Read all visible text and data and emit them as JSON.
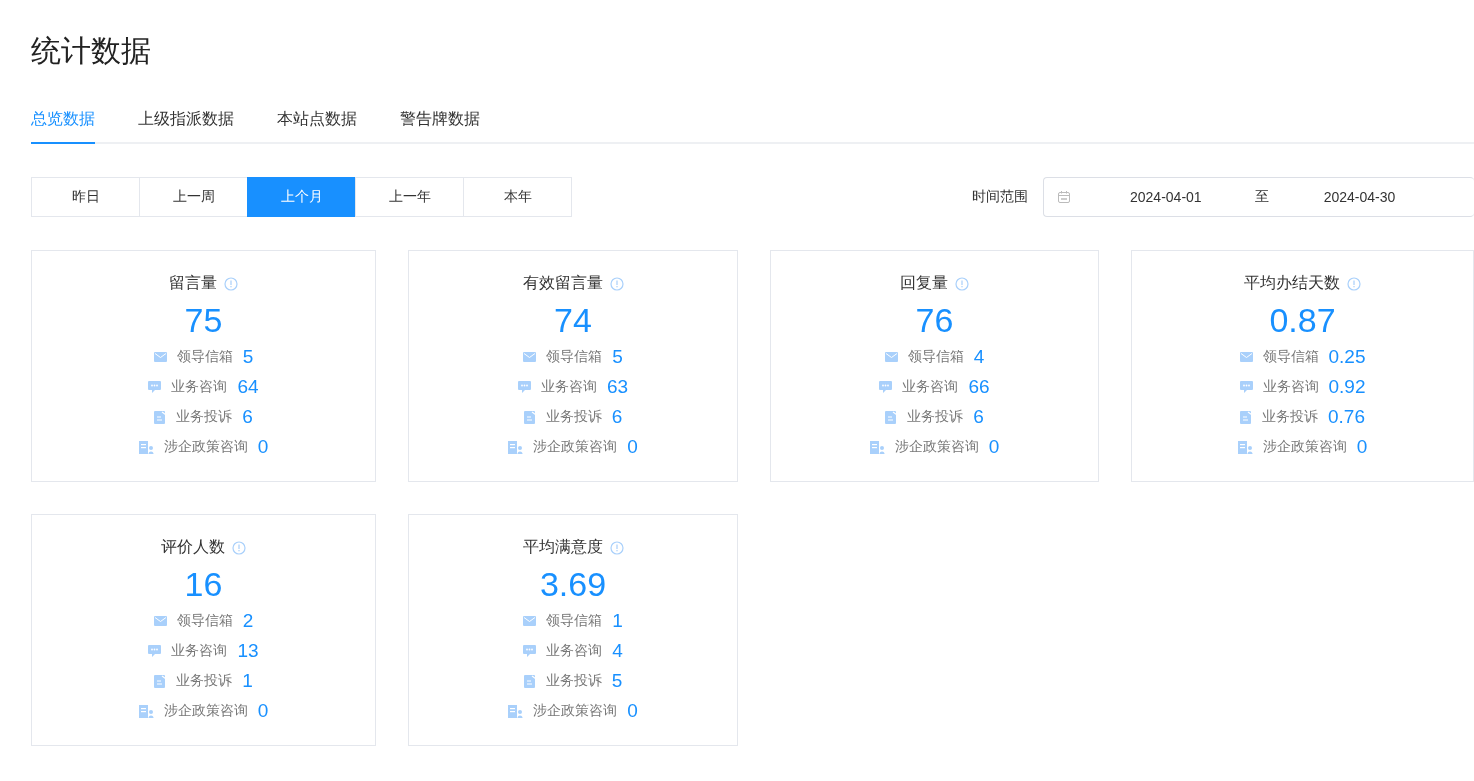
{
  "page_title": "统计数据",
  "tabs": [
    {
      "label": "总览数据",
      "selected": true
    },
    {
      "label": "上级指派数据",
      "selected": false
    },
    {
      "label": "本站点数据",
      "selected": false
    },
    {
      "label": "警告牌数据",
      "selected": false
    }
  ],
  "periods": [
    {
      "label": "昨日",
      "selected": false
    },
    {
      "label": "上一周",
      "selected": false
    },
    {
      "label": "上个月",
      "selected": true
    },
    {
      "label": "上一年",
      "selected": false
    },
    {
      "label": "本年",
      "selected": false
    }
  ],
  "date_range": {
    "label": "时间范围",
    "start": "2024-04-01",
    "separator": "至",
    "end": "2024-04-30"
  },
  "cards": [
    {
      "title": "留言量",
      "value": "75",
      "items": [
        {
          "kind": "mail",
          "label": "领导信箱",
          "value": "5"
        },
        {
          "kind": "chat",
          "label": "业务咨询",
          "value": "64"
        },
        {
          "kind": "note",
          "label": "业务投诉",
          "value": "6"
        },
        {
          "kind": "building",
          "label": "涉企政策咨询",
          "value": "0"
        }
      ]
    },
    {
      "title": "有效留言量",
      "value": "74",
      "items": [
        {
          "kind": "mail",
          "label": "领导信箱",
          "value": "5"
        },
        {
          "kind": "chat",
          "label": "业务咨询",
          "value": "63"
        },
        {
          "kind": "note",
          "label": "业务投诉",
          "value": "6"
        },
        {
          "kind": "building",
          "label": "涉企政策咨询",
          "value": "0"
        }
      ]
    },
    {
      "title": "回复量",
      "value": "76",
      "items": [
        {
          "kind": "mail",
          "label": "领导信箱",
          "value": "4"
        },
        {
          "kind": "chat",
          "label": "业务咨询",
          "value": "66"
        },
        {
          "kind": "note",
          "label": "业务投诉",
          "value": "6"
        },
        {
          "kind": "building",
          "label": "涉企政策咨询",
          "value": "0"
        }
      ]
    },
    {
      "title": "平均办结天数",
      "value": "0.87",
      "items": [
        {
          "kind": "mail",
          "label": "领导信箱",
          "value": "0.25"
        },
        {
          "kind": "chat",
          "label": "业务咨询",
          "value": "0.92"
        },
        {
          "kind": "note",
          "label": "业务投诉",
          "value": "0.76"
        },
        {
          "kind": "building",
          "label": "涉企政策咨询",
          "value": "0"
        }
      ]
    },
    {
      "title": "评价人数",
      "value": "16",
      "items": [
        {
          "kind": "mail",
          "label": "领导信箱",
          "value": "2"
        },
        {
          "kind": "chat",
          "label": "业务咨询",
          "value": "13"
        },
        {
          "kind": "note",
          "label": "业务投诉",
          "value": "1"
        },
        {
          "kind": "building",
          "label": "涉企政策咨询",
          "value": "0"
        }
      ]
    },
    {
      "title": "平均满意度",
      "value": "3.69",
      "items": [
        {
          "kind": "mail",
          "label": "领导信箱",
          "value": "1"
        },
        {
          "kind": "chat",
          "label": "业务咨询",
          "value": "4"
        },
        {
          "kind": "note",
          "label": "业务投诉",
          "value": "5"
        },
        {
          "kind": "building",
          "label": "涉企政策咨询",
          "value": "0"
        }
      ]
    }
  ]
}
